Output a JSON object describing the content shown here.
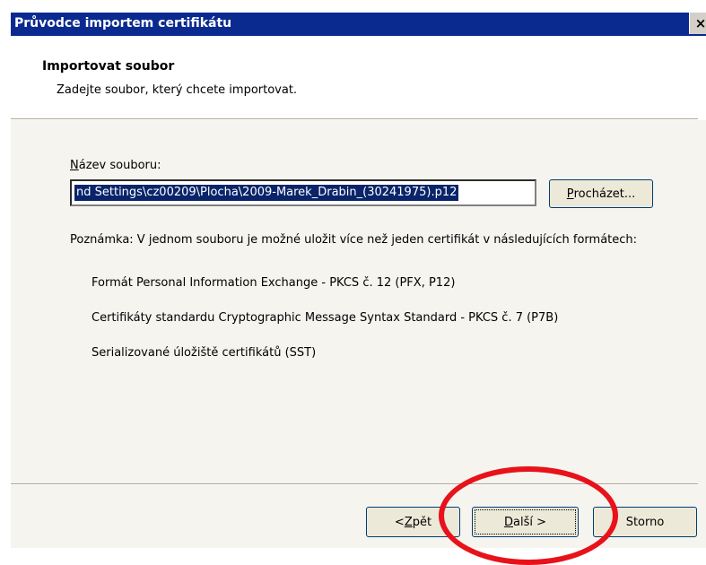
{
  "window": {
    "title": "Průvodce importem certifikátu",
    "close_label": "×"
  },
  "header": {
    "title": "Importovat soubor",
    "subtitle": "Zadejte soubor, který chcete importovat."
  },
  "file": {
    "label_accesskey": "N",
    "label_rest": "ázev souboru:",
    "value": "nd Settings\\cz00209\\Plocha\\2009-Marek_Drabin_(30241975).p12",
    "browse_accesskey": "P",
    "browse_rest": "rocházet..."
  },
  "note": {
    "text": "Poznámka: V jednom souboru je možné uložit více než jeden certifikát v následujících formátech:",
    "formats": [
      "Formát Personal Information Exchange - PKCS č. 12 (PFX, P12)",
      "Certifikáty standardu Cryptographic Message Syntax Standard - PKCS č. 7 (P7B)",
      "Serializované úložiště certifikátů (SST)"
    ]
  },
  "buttons": {
    "back_prefix": "< ",
    "back_accesskey": "Z",
    "back_rest": "pět",
    "next_accesskey": "D",
    "next_rest": "alší >",
    "cancel": "Storno"
  },
  "colors": {
    "highlight_circle": "#e8121a",
    "titlebar": "#0b2a8f",
    "selection": "#0a246a"
  }
}
